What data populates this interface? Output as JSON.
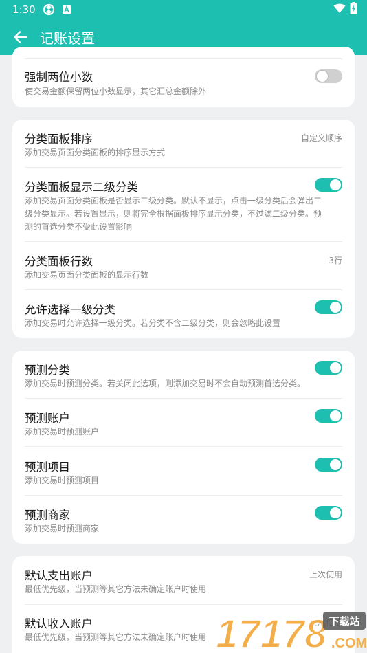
{
  "status_bar": {
    "time": "1:30",
    "icons": [
      "sync-icon",
      "a-badge-icon",
      "wifi-icon",
      "battery-charging-icon"
    ]
  },
  "app_bar": {
    "title": "记账设置",
    "back_icon": "arrow-left-icon"
  },
  "colors": {
    "primary": "#1cbfb0",
    "background": "#eef0f1",
    "card": "#ffffff",
    "toggle_off": "#d0d0d0"
  },
  "sections": [
    {
      "items": [
        {
          "title": "强制两位小数",
          "desc": "使交易金额保留两位小数显示，其它汇总金额除外",
          "toggle": false
        }
      ]
    },
    {
      "items": [
        {
          "title": "分类面板排序",
          "desc": "添加交易页面分类面板的排序显示方式",
          "value": "自定义顺序"
        },
        {
          "title": "分类面板显示二级分类",
          "desc": "添加交易页面分类面板是否显示二级分类。默认不显示，点击一级分类后会弹出二级分类显示。若设置显示，则将完全根据面板排序显示分类，不过滤二级分类。预测的首选分类不受此设置影响",
          "desc_lines": [
            "添加交易页面分类面板是否显示二级分类。默认不显示，点击一级分类后会弹出二",
            "级分类显示。若设置显示，则将完全根据面板排序显示分类，不过滤二级分类。预",
            "测的首选分类不受此设置影响"
          ],
          "toggle": true
        },
        {
          "title": "分类面板行数",
          "desc": "添加交易页面分类面板的显示行数",
          "value": "3行"
        },
        {
          "title": "允许选择一级分类",
          "desc": "添加交易时允许选择一级分类。若分类不含二级分类，则会忽略此设置",
          "toggle": true
        }
      ]
    },
    {
      "items": [
        {
          "title": "预测分类",
          "desc": "添加交易时预测分类。若关闭此选项，则添加交易时不会自动预测首选分类。",
          "toggle": true
        },
        {
          "title": "预测账户",
          "desc": "添加交易时预测账户",
          "toggle": true
        },
        {
          "title": "预测项目",
          "desc": "添加交易时预测项目",
          "toggle": true
        },
        {
          "title": "预测商家",
          "desc": "添加交易时预测商家",
          "toggle": true
        }
      ]
    },
    {
      "items": [
        {
          "title": "默认支出账户",
          "desc": "最低优先级，当预测等其它方法未确定账户时使用",
          "value": "上次使用"
        },
        {
          "title": "默认收入账户",
          "desc": "最低优先级，当预测等其它方法未确定账户时使用",
          "value": "上次使用"
        }
      ]
    }
  ],
  "watermark": {
    "logo_text": "17178",
    "badge": "下载站",
    "domain": ".COM"
  }
}
